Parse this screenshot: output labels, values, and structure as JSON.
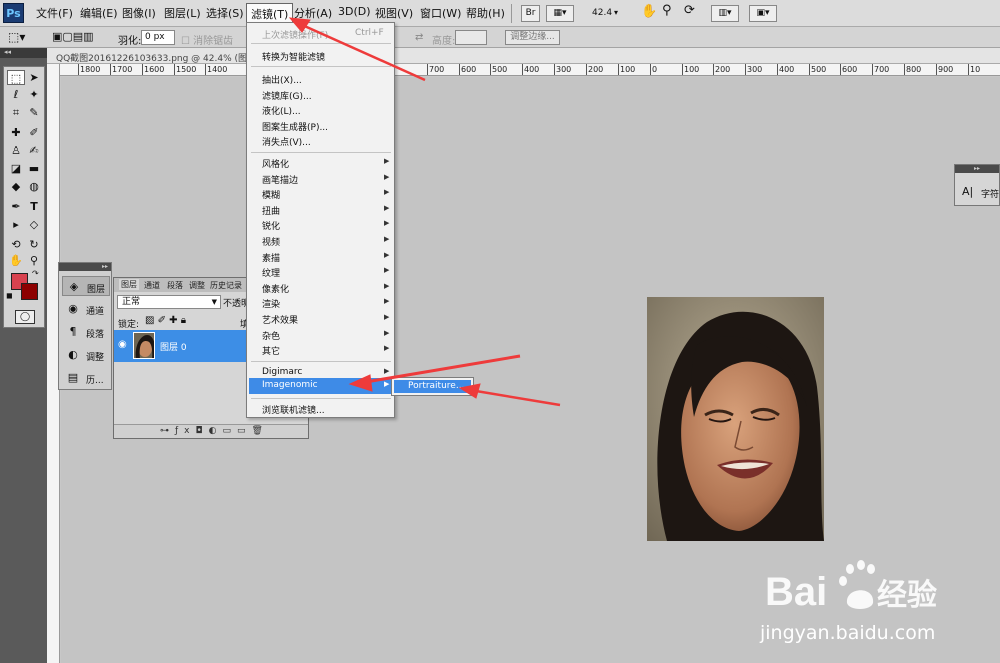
{
  "app": {
    "logo": "Ps"
  },
  "menubar": {
    "items": [
      "文件(F)",
      "编辑(E)",
      "图像(I)",
      "图层(L)",
      "选择(S)",
      "滤镜(T)",
      "分析(A)",
      "3D(D)",
      "视图(V)",
      "窗口(W)",
      "帮助(H)"
    ],
    "br_label": "Br",
    "zoom": "42.4"
  },
  "options": {
    "feather_label": "羽化:",
    "feather_value": "0 px",
    "antialias_label": "消除锯齿",
    "height_label": "高度:",
    "refine_edge": "调整边缘..."
  },
  "document": {
    "tab_title": "QQ截图20161226103633.png @ 42.4% (图层 0, R"
  },
  "ruler": {
    "labels": [
      "1800",
      "1700",
      "1600",
      "1500",
      "1400",
      "700",
      "600",
      "500",
      "400",
      "300",
      "200",
      "100",
      "0",
      "100",
      "200",
      "300",
      "400",
      "500",
      "600",
      "700",
      "800",
      "900",
      "10"
    ]
  },
  "filter_menu": {
    "last_filter": "上次滤镜操作(F)",
    "last_filter_shortcut": "Ctrl+F",
    "convert_smart": "转换为智能滤镜",
    "group1": [
      "抽出(X)...",
      "滤镜库(G)...",
      "液化(L)...",
      "图案生成器(P)...",
      "消失点(V)..."
    ],
    "group2": [
      "风格化",
      "画笔描边",
      "模糊",
      "扭曲",
      "锐化",
      "视频",
      "素描",
      "纹理",
      "像素化",
      "渲染",
      "艺术效果",
      "杂色",
      "其它"
    ],
    "digimarc": "Digimarc",
    "imagenomic": "Imagenomic",
    "browse_online": "浏览联机滤镜..."
  },
  "submenu": {
    "portraiture": "Portraiture..."
  },
  "dock": {
    "items": [
      {
        "label": "图层",
        "icon": "layers-icon"
      },
      {
        "label": "通道",
        "icon": "channels-icon"
      },
      {
        "label": "段落",
        "icon": "paragraph-icon"
      },
      {
        "label": "调整",
        "icon": "adjust-icon"
      },
      {
        "label": "历...",
        "icon": "history-icon"
      }
    ]
  },
  "layers_panel": {
    "tabs": [
      "图层",
      "通道",
      "段落",
      "调整",
      "历史记录"
    ],
    "blend_mode": "正常",
    "opacity_label": "不透明",
    "lock_label": "锁定:",
    "fill_label": "填",
    "layer_name": "图层 0"
  },
  "right_panel": {
    "label": "字符"
  },
  "watermark": {
    "brand": "Bai",
    "brand2": "经验",
    "url": "jingyan.baidu.com"
  }
}
